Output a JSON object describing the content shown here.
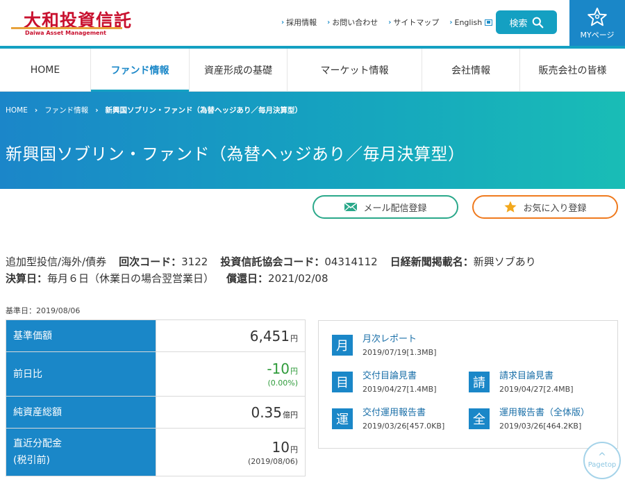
{
  "header": {
    "logo_jp": "大和投資信託",
    "logo_en": "Daiwa Asset Management",
    "util_links": [
      "採用情報",
      "お問い合わせ",
      "サイトマップ",
      "English"
    ],
    "search_label": "検索",
    "my_page_label": "MYページ"
  },
  "nav": {
    "items": [
      {
        "label": "HOME"
      },
      {
        "label": "ファンド情報"
      },
      {
        "label": "資産形成の基礎"
      },
      {
        "label": "マーケット情報"
      },
      {
        "label": "会社情報"
      },
      {
        "label": "販売会社の皆様"
      }
    ]
  },
  "breadcrumb": {
    "home": "HOME",
    "fund_info": "ファンド情報",
    "current": "新興国ソブリン・ファンド（為替ヘッジあり／毎月決算型）"
  },
  "page_title": "新興国ソブリン・ファンド（為替ヘッジあり／毎月決算型）",
  "actions": {
    "mail_label": "メール配信登録",
    "fav_label": "お気に入り登録"
  },
  "fund_info": {
    "category": "追加型投信/海外/債券",
    "code_label": "回次コード：",
    "code_value": "3122",
    "assoc_label": "投資信託協会コード：",
    "assoc_value": "04314112",
    "nikkei_label": "日経新聞掲載名：",
    "nikkei_value": "新興ソブあり",
    "settle_label": "決算日：",
    "settle_value": "毎月６日（休業日の場合翌営業日）",
    "redeem_label": "償還日：",
    "redeem_value": "2021/02/08"
  },
  "base_date": "基準日：2019/08/06",
  "price_table": {
    "nav_label": "基準価額",
    "nav_value": "6,451",
    "nav_unit": "円",
    "change_label": "前日比",
    "change_value": "-10",
    "change_unit": "円",
    "change_pct": "(0.00%)",
    "assets_label": "純資産総額",
    "assets_value": "0.35",
    "assets_unit": "億円",
    "dist_label_1": "直近分配金",
    "dist_label_2": "(税引前)",
    "dist_value": "10",
    "dist_unit": "円",
    "dist_date": "(2019/08/06)"
  },
  "documents": [
    {
      "icon": "月",
      "title": "月次レポート",
      "meta": "2019/07/19[1.3MB]"
    },
    {
      "icon": "目",
      "title": "交付目論見書",
      "meta": "2019/04/27[1.4MB]"
    },
    {
      "icon": "請",
      "title": "請求目論見書",
      "meta": "2019/04/27[2.4MB]"
    },
    {
      "icon": "運",
      "title": "交付運用報告書",
      "meta": "2019/03/26[457.0KB]"
    },
    {
      "icon": "全",
      "title": "運用報告書（全体版）",
      "meta": "2019/03/26[464.2KB]"
    }
  ],
  "pagetop_label": "Pagetop",
  "colors": {
    "primary_blue": "#1a87c8",
    "teal": "#14a0c2",
    "logo_red": "#c8102e",
    "mail_green": "#2aa88a",
    "fav_orange": "#ef7a1e",
    "change_green": "#2e9b3a"
  }
}
